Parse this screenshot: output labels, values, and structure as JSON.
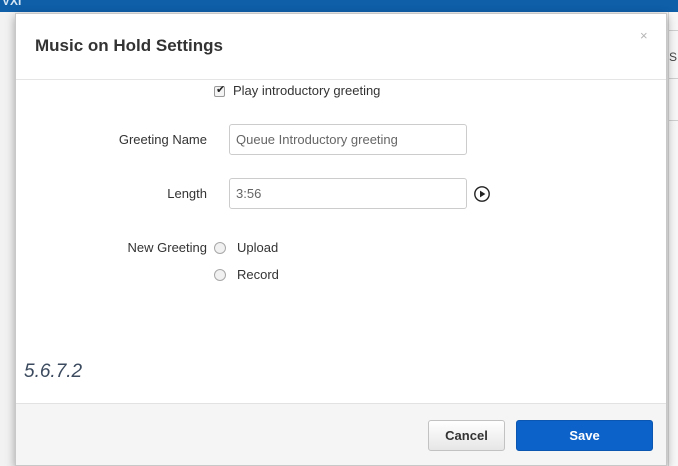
{
  "background": {
    "top_bar_text": "VXI",
    "right_edge_glyph": "S"
  },
  "modal": {
    "title": "Music on Hold Settings",
    "close_glyph": "×"
  },
  "form": {
    "play_greeting": {
      "checked": true,
      "label": "Play introductory greeting"
    },
    "greeting_name": {
      "label": "Greeting Name",
      "value": "Queue Introductory greeting"
    },
    "length": {
      "label": "Length",
      "value": "3:56"
    },
    "new_greeting": {
      "label": "New Greeting",
      "options": [
        "Upload",
        "Record"
      ]
    }
  },
  "reference_label": "5.6.7.2",
  "footer": {
    "cancel_label": "Cancel",
    "save_label": "Save"
  },
  "colors": {
    "brand_blue": "#0d62c9",
    "top_bar": "#0e5ea8"
  },
  "icons": {
    "play": "play-circle-icon",
    "close": "close-icon",
    "checkbox": "checkbox-checked-icon"
  }
}
